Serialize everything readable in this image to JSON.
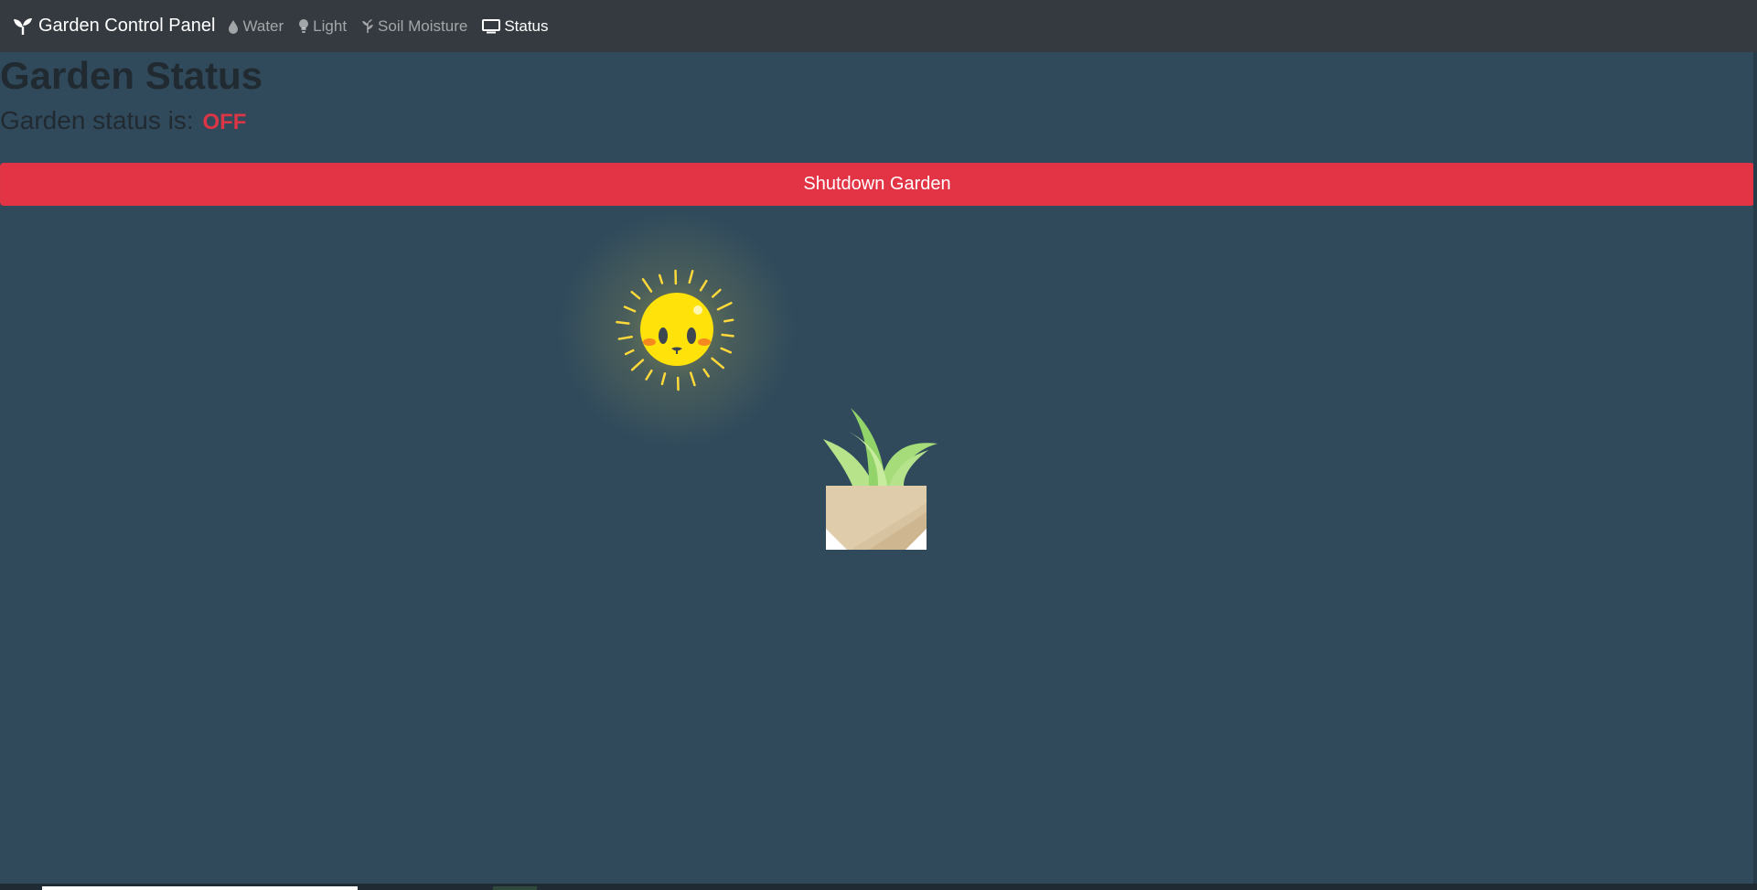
{
  "navbar": {
    "brand": "Garden Control Panel",
    "brand_icon": "seedling-icon",
    "links": [
      {
        "label": "Water",
        "icon": "droplet-icon",
        "active": false
      },
      {
        "label": "Light",
        "icon": "lightbulb-icon",
        "active": false
      },
      {
        "label": "Soil Moisture",
        "icon": "seedling-icon",
        "active": false
      },
      {
        "label": "Status",
        "icon": "monitor-icon",
        "active": true
      }
    ]
  },
  "main": {
    "title": "Garden Status",
    "status_label": "Garden status is:",
    "status_value": "OFF",
    "shutdown_button": "Shutdown Garden"
  },
  "colors": {
    "background": "#304a5c",
    "navbar": "#343a40",
    "danger": "#dc3545",
    "sun": "#ffe20a",
    "leaf": "#9bd96a",
    "pot": "#d8c3a0"
  }
}
